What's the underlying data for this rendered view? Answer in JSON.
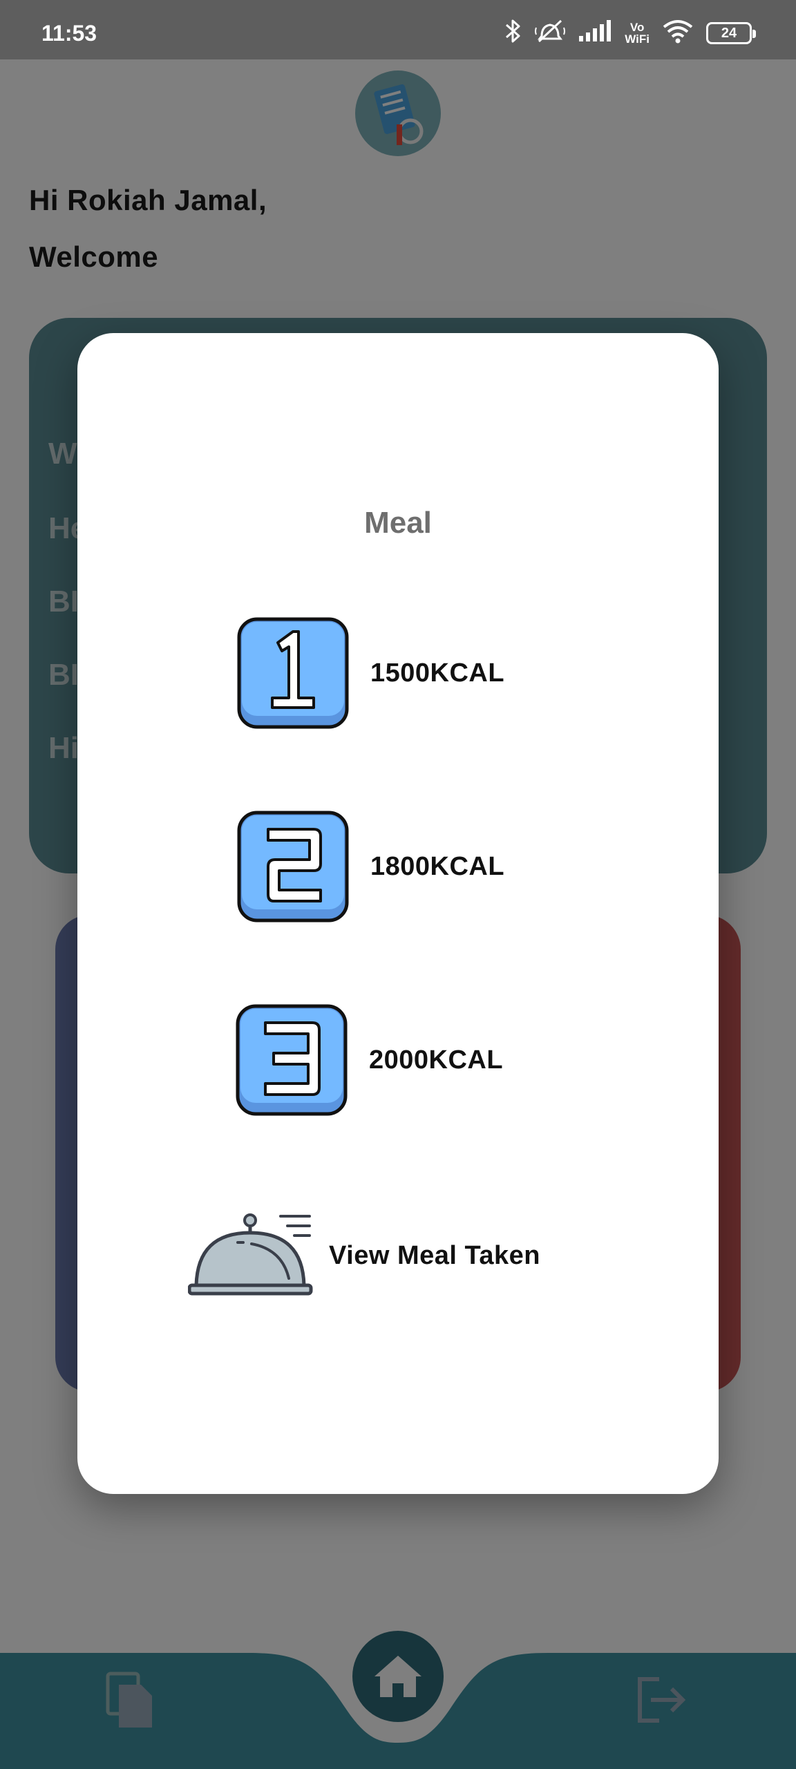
{
  "status_bar": {
    "time": "11:53",
    "vowifi_top": "Vo",
    "vowifi_bottom": "WiFi",
    "battery": "24"
  },
  "home": {
    "greeting": "Hi Rokiah Jamal,",
    "welcome": "Welcome",
    "info_rows_partial": [
      "W",
      "He",
      "BI",
      "BI",
      "Hi"
    ]
  },
  "dialog": {
    "title": "Meal",
    "options": [
      {
        "number": "1",
        "label": "1500KCAL",
        "icon": "number-1-icon"
      },
      {
        "number": "2",
        "label": "1800KCAL",
        "icon": "number-2-icon"
      },
      {
        "number": "3",
        "label": "2000KCAL",
        "icon": "number-3-icon"
      }
    ],
    "view_meal_taken": "View Meal Taken"
  },
  "nav": {
    "left_icon": "document-icon",
    "center_icon": "home-icon",
    "right_icon": "logout-icon"
  },
  "colors": {
    "teal": "#1f4a54",
    "icon_blue": "#74b9ff",
    "icon_blue_dark": "#5a95e0"
  }
}
